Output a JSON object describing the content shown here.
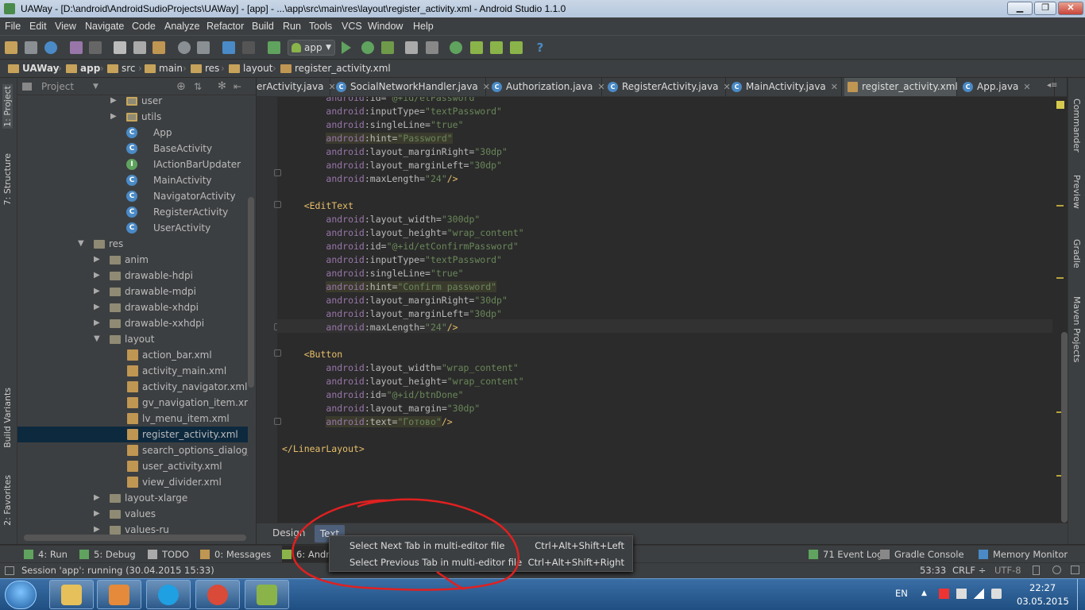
{
  "window": {
    "title": "UAWay - [D:\\android\\AndroidSudioProjects\\UAWay] - [app] - ...\\app\\src\\main\\res\\layout\\register_activity.xml - Android Studio 1.1.0",
    "min_label": "▁",
    "max_label": "❐",
    "close_label": "✕"
  },
  "menu": [
    "File",
    "Edit",
    "View",
    "Navigate",
    "Code",
    "Analyze",
    "Refactor",
    "Build",
    "Run",
    "Tools",
    "VCS",
    "Window",
    "Help"
  ],
  "toolbar": {
    "run_config": "app"
  },
  "breadcrumbs": [
    "UAWay",
    "app",
    "src",
    "main",
    "res",
    "layout",
    "register_activity.xml"
  ],
  "left_tools": {
    "project": "1: Project",
    "structure": "7: Structure",
    "build_variants": "Build Variants",
    "favorites": "2: Favorites"
  },
  "project_panel": {
    "title": "Project",
    "tree": [
      {
        "label": "user",
        "type": "pkg",
        "depth": 0
      },
      {
        "label": "utils",
        "type": "pkg",
        "depth": 0
      },
      {
        "label": "App",
        "type": "class",
        "depth": 1
      },
      {
        "label": "BaseActivity",
        "type": "class",
        "depth": 1
      },
      {
        "label": "IActionBarUpdater",
        "type": "interface",
        "depth": 1
      },
      {
        "label": "MainActivity",
        "type": "class",
        "depth": 1
      },
      {
        "label": "NavigatorActivity",
        "type": "class",
        "depth": 1
      },
      {
        "label": "RegisterActivity",
        "type": "class",
        "depth": 1
      },
      {
        "label": "UserActivity",
        "type": "class",
        "depth": 1
      },
      {
        "label": "res",
        "type": "res",
        "depth": -1
      },
      {
        "label": "anim",
        "type": "folder",
        "depth": 2
      },
      {
        "label": "drawable-hdpi",
        "type": "folder",
        "depth": 2
      },
      {
        "label": "drawable-mdpi",
        "type": "folder",
        "depth": 2
      },
      {
        "label": "drawable-xhdpi",
        "type": "folder",
        "depth": 2
      },
      {
        "label": "drawable-xxhdpi",
        "type": "folder",
        "depth": 2
      },
      {
        "label": "layout",
        "type": "folder-open",
        "depth": 2
      },
      {
        "label": "action_bar.xml",
        "type": "xml",
        "depth": 3
      },
      {
        "label": "activity_main.xml",
        "type": "xml",
        "depth": 3
      },
      {
        "label": "activity_navigator.xml",
        "type": "xml",
        "depth": 3
      },
      {
        "label": "gv_navigation_item.xml",
        "type": "xml",
        "depth": 3
      },
      {
        "label": "lv_menu_item.xml",
        "type": "xml",
        "depth": 3
      },
      {
        "label": "register_activity.xml",
        "type": "xml",
        "depth": 3,
        "selected": true
      },
      {
        "label": "search_options_dialog_lv",
        "type": "xml",
        "depth": 3
      },
      {
        "label": "user_activity.xml",
        "type": "xml",
        "depth": 3
      },
      {
        "label": "view_divider.xml",
        "type": "xml",
        "depth": 3
      },
      {
        "label": "layout-xlarge",
        "type": "folder",
        "depth": 2
      },
      {
        "label": "values",
        "type": "folder",
        "depth": 2
      },
      {
        "label": "values-ru",
        "type": "folder",
        "depth": 2
      }
    ]
  },
  "editor_tabs": [
    {
      "label": "erActivity.java",
      "kind": "class"
    },
    {
      "label": "SocialNetworkHandler.java",
      "kind": "class"
    },
    {
      "label": "Authorization.java",
      "kind": "class"
    },
    {
      "label": "RegisterActivity.java",
      "kind": "class"
    },
    {
      "label": "MainActivity.java",
      "kind": "class"
    },
    {
      "label": "register_activity.xml",
      "kind": "xml",
      "active": true
    },
    {
      "label": "App.java",
      "kind": "class"
    }
  ],
  "code_lines": [
    {
      "i": 2,
      "ns": "android",
      "a": "id",
      "v": "\"@+id/etPassword\""
    },
    {
      "i": 2,
      "ns": "android",
      "a": "inputType",
      "v": "\"textPassword\""
    },
    {
      "i": 2,
      "ns": "android",
      "a": "singleLine",
      "v": "\"true\""
    },
    {
      "i": 2,
      "ns": "android",
      "a": "hint",
      "v": "\"Password\"",
      "hl": true
    },
    {
      "i": 2,
      "ns": "android",
      "a": "layout_marginRight",
      "v": "\"30dp\""
    },
    {
      "i": 2,
      "ns": "android",
      "a": "layout_marginLeft",
      "v": "\"30dp\""
    },
    {
      "i": 2,
      "ns": "android",
      "a": "maxLength",
      "v": "\"24\"",
      "end": "/>"
    },
    {
      "blank": true
    },
    {
      "i": 1,
      "tag": "<EditText"
    },
    {
      "i": 2,
      "ns": "android",
      "a": "layout_width",
      "v": "\"300dp\""
    },
    {
      "i": 2,
      "ns": "android",
      "a": "layout_height",
      "v": "\"wrap_content\""
    },
    {
      "i": 2,
      "ns": "android",
      "a": "id",
      "v": "\"@+id/etConfirmPassword\""
    },
    {
      "i": 2,
      "ns": "android",
      "a": "inputType",
      "v": "\"textPassword\""
    },
    {
      "i": 2,
      "ns": "android",
      "a": "singleLine",
      "v": "\"true\""
    },
    {
      "i": 2,
      "ns": "android",
      "a": "hint",
      "v": "\"Confirm password\"",
      "hl": true
    },
    {
      "i": 2,
      "ns": "android",
      "a": "layout_marginRight",
      "v": "\"30dp\""
    },
    {
      "i": 2,
      "ns": "android",
      "a": "layout_marginLeft",
      "v": "\"30dp\""
    },
    {
      "i": 2,
      "ns": "android",
      "a": "maxLength",
      "v": "\"24\"",
      "end": "/>"
    },
    {
      "blank": true
    },
    {
      "i": 1,
      "tag": "<Button"
    },
    {
      "i": 2,
      "ns": "android",
      "a": "layout_width",
      "v": "\"wrap_content\""
    },
    {
      "i": 2,
      "ns": "android",
      "a": "layout_height",
      "v": "\"wrap_content\""
    },
    {
      "i": 2,
      "ns": "android",
      "a": "id",
      "v": "\"@+id/btnDone\""
    },
    {
      "i": 2,
      "ns": "android",
      "a": "layout_margin",
      "v": "\"30dp\""
    },
    {
      "i": 2,
      "ns": "android",
      "a": "text",
      "v": "\"Готово\"",
      "hl": true,
      "end": "/>"
    },
    {
      "blank": true
    },
    {
      "i": 0,
      "tag": "</LinearLayout>"
    }
  ],
  "right_tools": [
    "Commander",
    "Preview",
    "Gradle",
    "Maven Projects"
  ],
  "bottom_tabs": {
    "design": "Design",
    "text": "Text"
  },
  "tool_windows": [
    {
      "label": "4: Run",
      "color": "#5fa35f"
    },
    {
      "label": "5: Debug",
      "color": "#5fa35f"
    },
    {
      "label": "TODO",
      "color": "#aaaaaa"
    },
    {
      "label": "0: Messages",
      "color": "#c09653"
    },
    {
      "label": "6: Andro",
      "color": "#8ab44a"
    },
    {
      "label": "71  Event Log",
      "color": "#5fa35f"
    },
    {
      "label": "Gradle Console",
      "color": "#888888"
    },
    {
      "label": "Memory Monitor",
      "color": "#4a8ac6"
    }
  ],
  "status": {
    "message": "Session 'app': running (30.04.2015 15:33)",
    "position": "53:33",
    "line_sep": "CRLF ÷",
    "encoding": "UTF-8"
  },
  "popup": [
    {
      "label": "Select Next Tab in multi-editor file",
      "shortcut": "Ctrl+Alt+Shift+Left"
    },
    {
      "label": "Select Previous Tab in multi-editor file",
      "shortcut": "Ctrl+Alt+Shift+Right"
    }
  ],
  "taskbar": {
    "apps": [
      {
        "name": "explorer",
        "color": "#e6c05a"
      },
      {
        "name": "media-player",
        "color": "#e48a3a"
      },
      {
        "name": "skype",
        "color": "#1fa0e3"
      },
      {
        "name": "chrome",
        "color": "#d94a38"
      },
      {
        "name": "android-studio",
        "color": "#8ab44a"
      }
    ],
    "lang": "EN",
    "time": "22:27",
    "date": "03.05.2015"
  },
  "colors": {
    "annotation": "#e02020",
    "selection": "#0d293e",
    "accent": "#4e5f7a"
  }
}
